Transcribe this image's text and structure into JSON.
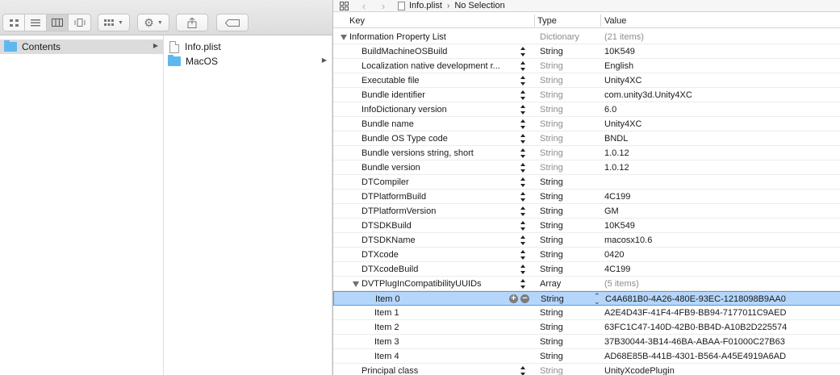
{
  "finder": {
    "columns": [
      {
        "items": [
          {
            "label": "Contents",
            "icon": "folder-icon",
            "selected": true,
            "has_children": true
          }
        ]
      },
      {
        "items": [
          {
            "label": "Info.plist",
            "icon": "document-icon",
            "selected": false,
            "has_children": false
          },
          {
            "label": "MacOS",
            "icon": "folder-icon",
            "selected": false,
            "has_children": true
          }
        ]
      }
    ]
  },
  "editor": {
    "jumpbar": {
      "file": "Info.plist",
      "selection": "No Selection"
    },
    "headers": {
      "key": "Key",
      "type": "Type",
      "value": "Value"
    },
    "root": {
      "key": "Information Property List",
      "type": "Dictionary",
      "value": "(21 items)"
    },
    "rows": [
      {
        "key": "BuildMachineOSBuild",
        "type": "String",
        "value": "10K549"
      },
      {
        "key": "Localization native development r...",
        "type": "String",
        "value": "English"
      },
      {
        "key": "Executable file",
        "type": "String",
        "value": "Unity4XC"
      },
      {
        "key": "Bundle identifier",
        "type": "String",
        "value": "com.unity3d.Unity4XC"
      },
      {
        "key": "InfoDictionary version",
        "type": "String",
        "value": "6.0"
      },
      {
        "key": "Bundle name",
        "type": "String",
        "value": "Unity4XC"
      },
      {
        "key": "Bundle OS Type code",
        "type": "String",
        "value": "BNDL"
      },
      {
        "key": "Bundle versions string, short",
        "type": "String",
        "value": "1.0.12"
      },
      {
        "key": "Bundle version",
        "type": "String",
        "value": "1.0.12"
      },
      {
        "key": "DTCompiler",
        "type": "String",
        "value": ""
      },
      {
        "key": "DTPlatformBuild",
        "type": "String",
        "value": "4C199"
      },
      {
        "key": "DTPlatformVersion",
        "type": "String",
        "value": "GM"
      },
      {
        "key": "DTSDKBuild",
        "type": "String",
        "value": "10K549"
      },
      {
        "key": "DTSDKName",
        "type": "String",
        "value": "macosx10.6"
      },
      {
        "key": "DTXcode",
        "type": "String",
        "value": "0420"
      },
      {
        "key": "DTXcodeBuild",
        "type": "String",
        "value": "4C199"
      }
    ],
    "array_row": {
      "key": "DVTPlugInCompatibilityUUIDs",
      "type": "Array",
      "value": "(5 items)"
    },
    "array_items": [
      {
        "key": "Item 0",
        "type": "String",
        "value": "C4A681B0-4A26-480E-93EC-1218098B9AA0"
      },
      {
        "key": "Item 1",
        "type": "String",
        "value": "A2E4D43F-41F4-4FB9-BB94-7177011C9AED"
      },
      {
        "key": "Item 2",
        "type": "String",
        "value": "63FC1C47-140D-42B0-BB4D-A10B2D225574"
      },
      {
        "key": "Item 3",
        "type": "String",
        "value": "37B30044-3B14-46BA-ABAA-F01000C27B63"
      },
      {
        "key": "Item 4",
        "type": "String",
        "value": "AD68E85B-441B-4301-B564-A45E4919A6AD"
      }
    ],
    "last_row": {
      "key": "Principal class",
      "type": "String",
      "value": "UnityXcodePlugin"
    },
    "grey_type_keys": [
      "Localization native development r...",
      "Executable file",
      "Bundle identifier",
      "InfoDictionary version",
      "Bundle name",
      "Bundle OS Type code",
      "Bundle versions string, short",
      "Bundle version",
      "Principal class"
    ]
  }
}
